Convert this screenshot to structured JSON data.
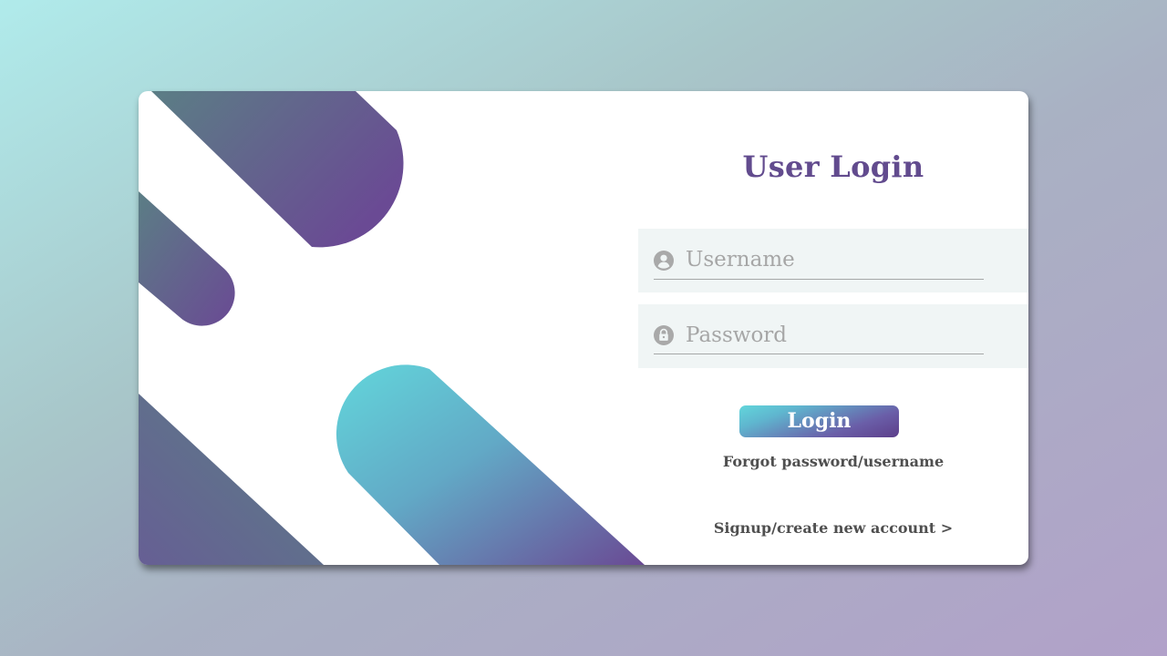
{
  "login": {
    "title": "User Login",
    "username": {
      "placeholder": "Username",
      "value": "",
      "icon": "user-circle-icon"
    },
    "password": {
      "placeholder": "Password",
      "value": "",
      "icon": "lock-circle-icon"
    },
    "login_label": "Login",
    "forgot_label": "Forgot password/username",
    "signup_label": "Signup/create new account >"
  },
  "colors": {
    "title": "#624b8e",
    "field_bg": "#f0f5f5",
    "gradient_teal": "#62d6db",
    "gradient_purple": "#6a4a94",
    "gradient_slate": "#5b7e85"
  }
}
